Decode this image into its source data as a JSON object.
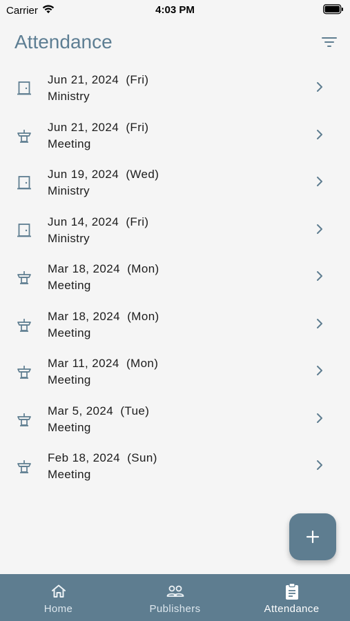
{
  "status_bar": {
    "carrier": "Carrier",
    "time": "4:03 PM"
  },
  "header": {
    "title": "Attendance"
  },
  "rows": [
    {
      "date": "Jun 21, 2024  (Fri)",
      "type": "Ministry",
      "icon": "door-icon"
    },
    {
      "date": "Jun 21, 2024  (Fri)",
      "type": "Meeting",
      "icon": "lectern-icon"
    },
    {
      "date": "Jun 19, 2024  (Wed)",
      "type": "Ministry",
      "icon": "door-icon"
    },
    {
      "date": "Jun 14, 2024  (Fri)",
      "type": "Ministry",
      "icon": "door-icon"
    },
    {
      "date": "Mar 18, 2024  (Mon)",
      "type": "Meeting",
      "icon": "lectern-icon"
    },
    {
      "date": "Mar 18, 2024  (Mon)",
      "type": "Meeting",
      "icon": "lectern-icon"
    },
    {
      "date": "Mar 11, 2024  (Mon)",
      "type": "Meeting",
      "icon": "lectern-icon"
    },
    {
      "date": "Mar 5, 2024  (Tue)",
      "type": "Meeting",
      "icon": "lectern-icon"
    },
    {
      "date": "Feb 18, 2024  (Sun)",
      "type": "Meeting",
      "icon": "lectern-icon"
    }
  ],
  "tabs": [
    {
      "label": "Home",
      "icon": "home-icon",
      "active": false
    },
    {
      "label": "Publishers",
      "icon": "people-icon",
      "active": false
    },
    {
      "label": "Attendance",
      "icon": "clipboard-icon",
      "active": true
    }
  ],
  "colors": {
    "accent": "#5e7d90",
    "title": "#5d7e93"
  }
}
